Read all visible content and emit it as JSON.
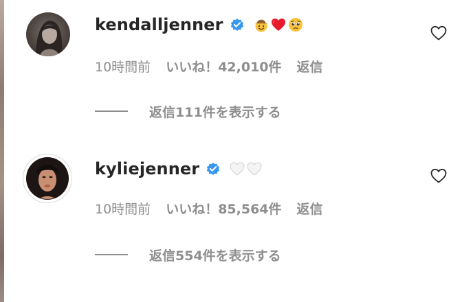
{
  "comments": [
    {
      "username": "kendalljenner",
      "verified": true,
      "emojis": [
        "cowboy-face",
        "red-heart",
        "pleading-face"
      ],
      "time": "10時間前",
      "likes": "いいね！42,010件",
      "reply": "返信",
      "view_replies": "返信111件を表示する"
    },
    {
      "username": "kyliejenner",
      "verified": true,
      "emojis": [
        "white-heart",
        "white-heart"
      ],
      "time": "10時間前",
      "likes": "いいね！85,564件",
      "reply": "返信",
      "view_replies": "返信554件を表示する"
    }
  ],
  "colors": {
    "text_primary": "#262626",
    "text_secondary": "#8e8e8e",
    "verified_blue": "#3897f0"
  }
}
